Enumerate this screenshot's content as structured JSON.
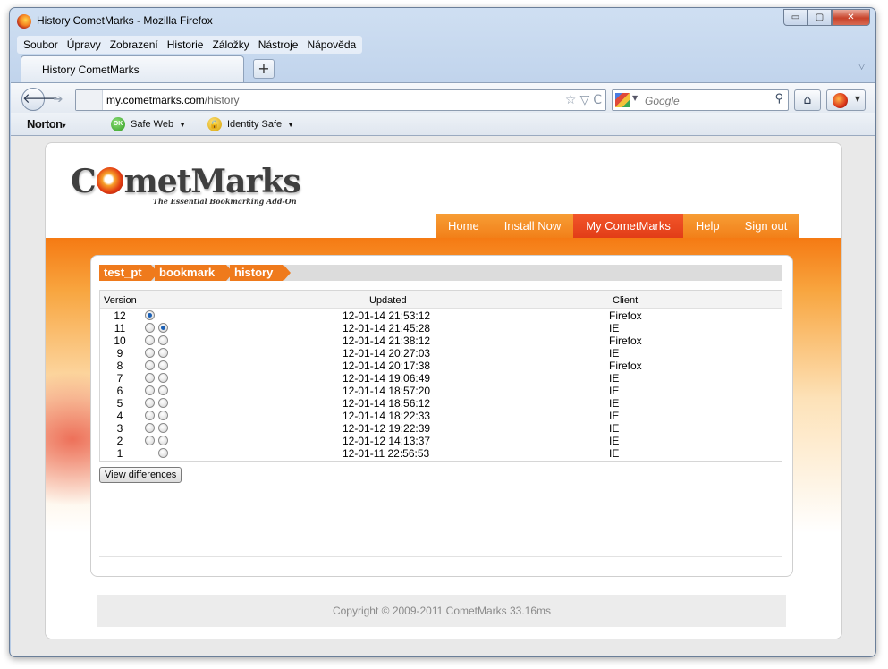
{
  "window": {
    "title": "History CometMarks - Mozilla Firefox",
    "controls": {
      "minimize": "▭",
      "maximize": "▢",
      "close": "✕"
    }
  },
  "menu": [
    "Soubor",
    "Úpravy",
    "Zobrazení",
    "Historie",
    "Záložky",
    "Nástroje",
    "Nápověda"
  ],
  "tabs": {
    "active_label": "History CometMarks",
    "new_tab": "+",
    "list_icon": "▽"
  },
  "nav": {
    "url_host": "my.cometmarks.com",
    "url_path": "/history",
    "search_placeholder": "Google",
    "back_icon": "🡐",
    "forward_icon": "➔",
    "home_icon": "⌂",
    "search_icon": "⚲",
    "url_icons": [
      "☆",
      "▽",
      "C"
    ]
  },
  "norton_bar": {
    "brand": "Norton",
    "safe_web": "Safe Web",
    "safe_web_badge": "OK",
    "identity_safe": "Identity Safe"
  },
  "site": {
    "logo_before": "C",
    "logo_after": "metMarks",
    "tagline": "The Essential Bookmarking Add-On",
    "nav": [
      {
        "label": "Home",
        "active": false
      },
      {
        "label": "Install Now",
        "active": false
      },
      {
        "label": "My CometMarks",
        "active": true
      },
      {
        "label": "Help",
        "active": false
      },
      {
        "label": "Sign out",
        "active": false
      }
    ],
    "breadcrumbs": [
      "test_pt",
      "bookmark",
      "history"
    ],
    "table": {
      "headers": {
        "version": "Version",
        "updated": "Updated",
        "client": "Client"
      },
      "rows": [
        {
          "version": "12",
          "updated": "12-01-14 21:53:12",
          "client": "Firefox",
          "radio_a": "checked",
          "radio_b": "none"
        },
        {
          "version": "11",
          "updated": "12-01-14 21:45:28",
          "client": "IE",
          "radio_a": "unchecked",
          "radio_b": "checked"
        },
        {
          "version": "10",
          "updated": "12-01-14 21:38:12",
          "client": "Firefox",
          "radio_a": "unchecked",
          "radio_b": "unchecked"
        },
        {
          "version": "9",
          "updated": "12-01-14 20:27:03",
          "client": "IE",
          "radio_a": "unchecked",
          "radio_b": "unchecked"
        },
        {
          "version": "8",
          "updated": "12-01-14 20:17:38",
          "client": "Firefox",
          "radio_a": "unchecked",
          "radio_b": "unchecked"
        },
        {
          "version": "7",
          "updated": "12-01-14 19:06:49",
          "client": "IE",
          "radio_a": "unchecked",
          "radio_b": "unchecked"
        },
        {
          "version": "6",
          "updated": "12-01-14 18:57:20",
          "client": "IE",
          "radio_a": "unchecked",
          "radio_b": "unchecked"
        },
        {
          "version": "5",
          "updated": "12-01-14 18:56:12",
          "client": "IE",
          "radio_a": "unchecked",
          "radio_b": "unchecked"
        },
        {
          "version": "4",
          "updated": "12-01-14 18:22:33",
          "client": "IE",
          "radio_a": "unchecked",
          "radio_b": "unchecked"
        },
        {
          "version": "3",
          "updated": "12-01-12 19:22:39",
          "client": "IE",
          "radio_a": "unchecked",
          "radio_b": "unchecked"
        },
        {
          "version": "2",
          "updated": "12-01-12 14:13:37",
          "client": "IE",
          "radio_a": "unchecked",
          "radio_b": "unchecked"
        },
        {
          "version": "1",
          "updated": "12-01-11 22:56:53",
          "client": "IE",
          "radio_a": "none",
          "radio_b": "unchecked"
        }
      ]
    },
    "view_differences": "View differences",
    "footer": "Copyright © 2009-2011 CometMarks 33.16ms"
  }
}
